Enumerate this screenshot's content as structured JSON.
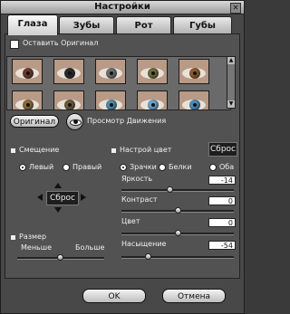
{
  "window": {
    "title": "Настройки"
  },
  "tabs": [
    {
      "label": "Глаза"
    },
    {
      "label": "Зубы"
    },
    {
      "label": "Рот"
    },
    {
      "label": "Губы"
    }
  ],
  "keep_original": {
    "label": "Оставить Оригинал"
  },
  "swatches": {
    "row1": [
      "#6a3a2a",
      "#2a2a2e",
      "#6b6f70",
      "#6c6a3c",
      "#8a5a2a"
    ],
    "row2": [
      "#8a6a3a",
      "#6a5a3a",
      "#4e8aa8",
      "#6aa0c8",
      "#4b8ab8"
    ]
  },
  "buttons": {
    "original": "Оригинал",
    "preview": "Просмотр Движения",
    "ok": "OK",
    "cancel": "Отмена"
  },
  "offset": {
    "title": "Смещение",
    "left": "Левый",
    "right": "Правый",
    "reset": "Сброс"
  },
  "size": {
    "title": "Размер",
    "less": "Меньше",
    "more": "Больше"
  },
  "color": {
    "title": "Настрой цвет",
    "reset": "Сброс",
    "pupils": "Зрачки",
    "whites": "Белки",
    "both": "Оба",
    "brightness_label": "Яркость",
    "brightness": "-14",
    "contrast_label": "Контраст",
    "contrast": "0",
    "color_label": "Цвет",
    "color_value": "0",
    "saturation_label": "Насыщение",
    "saturation": "-54"
  }
}
